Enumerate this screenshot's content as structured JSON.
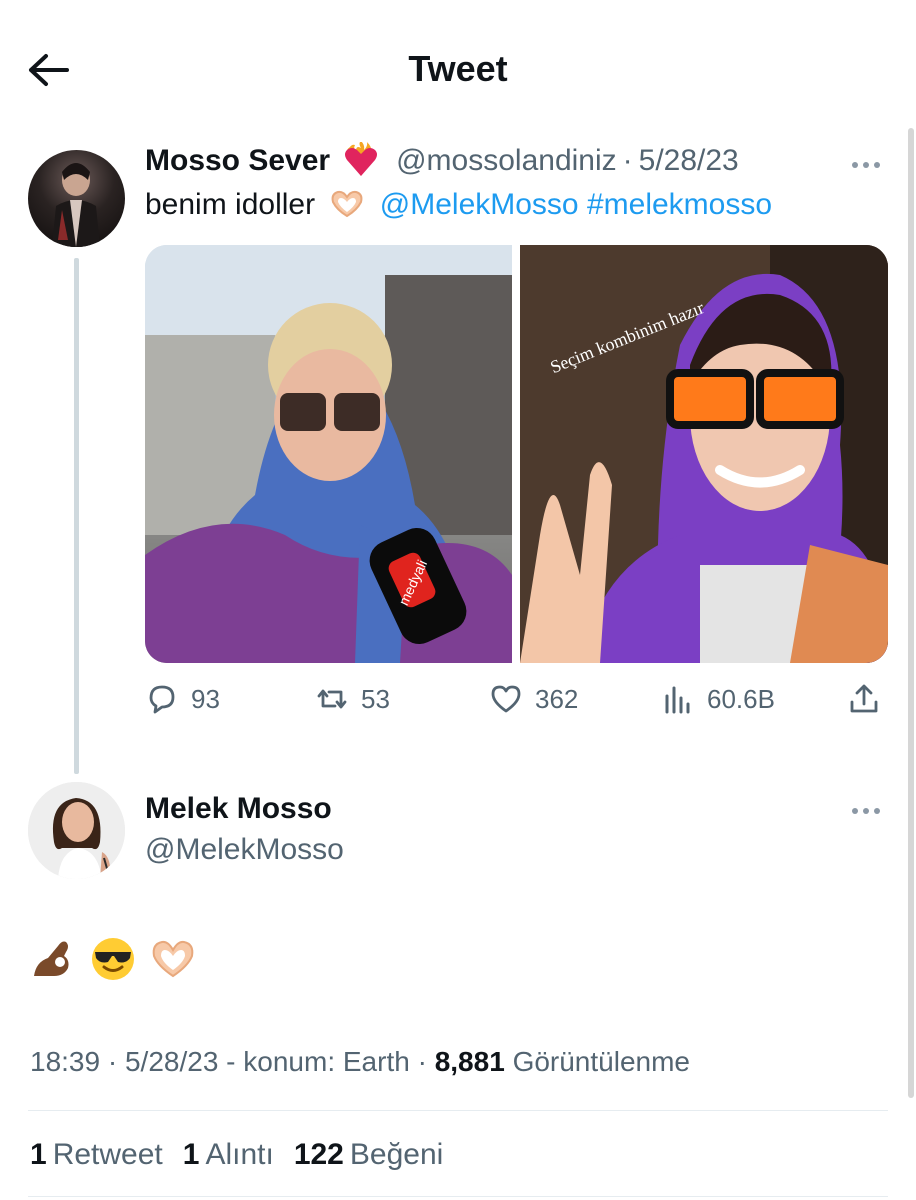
{
  "header": {
    "title": "Tweet"
  },
  "parent_tweet": {
    "display_name": "Mosso Sever",
    "name_emoji": "heart-on-fire",
    "handle": "@mossolandiniz",
    "separator": "·",
    "date": "5/28/23",
    "text_prefix": "benim idoller",
    "text_emoji": "heart-hands",
    "mention": "@MelekMosso",
    "hashtag": "#melekmosso",
    "media_overlay_text": "Seçim kombinim hazır",
    "media_mic_label": "medyali",
    "stats": {
      "replies": "93",
      "retweets": "53",
      "likes": "362",
      "views": "60.6B"
    }
  },
  "main_tweet": {
    "display_name": "Melek Mosso",
    "handle": "@MelekMosso",
    "emojis": [
      "ok-hand-dark",
      "smiling-face-with-sunglasses",
      "heart-hands"
    ],
    "meta": {
      "time": "18:39",
      "sep1": "·",
      "date": "5/28/23",
      "location": "- konum: Earth",
      "sep2": "·",
      "views_count": "8,881",
      "views_label": "Görüntülenme"
    },
    "stats": {
      "retweets": "1",
      "retweets_label": "Retweet",
      "quotes": "1",
      "quotes_label": "Alıntı",
      "likes": "122",
      "likes_label": "Beğeni"
    }
  },
  "colors": {
    "link": "#1d9bf0",
    "text": "#0f1419",
    "secondary": "#536471",
    "thread_line": "#cfd9de"
  }
}
